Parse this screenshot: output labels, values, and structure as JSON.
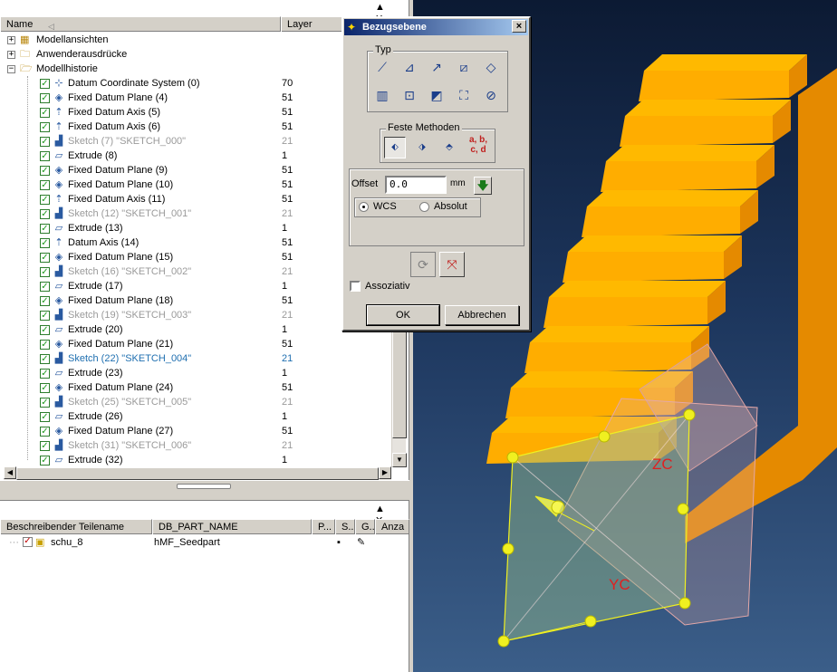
{
  "navigator": {
    "columns": {
      "name": "Name",
      "layer": "Layer"
    },
    "top_nodes": [
      {
        "label": "Modellansichten",
        "icon": "model-views-icon"
      },
      {
        "label": "Anwenderausdrücke",
        "icon": "folder-icon"
      },
      {
        "label": "Modellhistorie",
        "icon": "folder-open-icon"
      }
    ],
    "features": [
      {
        "label": "Datum Coordinate System (0)",
        "layer": "70",
        "state": "normal",
        "icon": "csys-icon"
      },
      {
        "label": "Fixed Datum Plane (4)",
        "layer": "51",
        "state": "normal",
        "icon": "datum-plane-icon"
      },
      {
        "label": "Fixed Datum Axis (5)",
        "layer": "51",
        "state": "normal",
        "icon": "datum-axis-icon"
      },
      {
        "label": "Fixed Datum Axis (6)",
        "layer": "51",
        "state": "normal",
        "icon": "datum-axis-icon"
      },
      {
        "label": "Sketch (7) \"SKETCH_000\"",
        "layer": "21",
        "state": "dim",
        "icon": "sketch-icon"
      },
      {
        "label": "Extrude (8)",
        "layer": "1",
        "state": "normal",
        "icon": "extrude-icon"
      },
      {
        "label": "Fixed Datum Plane (9)",
        "layer": "51",
        "state": "normal",
        "icon": "datum-plane-icon"
      },
      {
        "label": "Fixed Datum Plane (10)",
        "layer": "51",
        "state": "normal",
        "icon": "datum-plane-icon"
      },
      {
        "label": "Fixed Datum Axis (11)",
        "layer": "51",
        "state": "normal",
        "icon": "datum-axis-icon"
      },
      {
        "label": "Sketch (12) \"SKETCH_001\"",
        "layer": "21",
        "state": "dim",
        "icon": "sketch-icon"
      },
      {
        "label": "Extrude (13)",
        "layer": "1",
        "state": "normal",
        "icon": "extrude-icon"
      },
      {
        "label": "Datum Axis (14)",
        "layer": "51",
        "state": "normal",
        "icon": "datum-axis-icon"
      },
      {
        "label": "Fixed Datum Plane (15)",
        "layer": "51",
        "state": "normal",
        "icon": "datum-plane-icon"
      },
      {
        "label": "Sketch (16) \"SKETCH_002\"",
        "layer": "21",
        "state": "dim",
        "icon": "sketch-icon"
      },
      {
        "label": "Extrude (17)",
        "layer": "1",
        "state": "normal",
        "icon": "extrude-icon"
      },
      {
        "label": "Fixed Datum Plane (18)",
        "layer": "51",
        "state": "normal",
        "icon": "datum-plane-icon"
      },
      {
        "label": "Sketch (19) \"SKETCH_003\"",
        "layer": "21",
        "state": "dim",
        "icon": "sketch-icon"
      },
      {
        "label": "Extrude (20)",
        "layer": "1",
        "state": "normal",
        "icon": "extrude-icon"
      },
      {
        "label": "Fixed Datum Plane (21)",
        "layer": "51",
        "state": "normal",
        "icon": "datum-plane-icon"
      },
      {
        "label": "Sketch (22) \"SKETCH_004\"",
        "layer": "21",
        "state": "active",
        "icon": "sketch-icon"
      },
      {
        "label": "Extrude (23)",
        "layer": "1",
        "state": "normal",
        "icon": "extrude-icon"
      },
      {
        "label": "Fixed Datum Plane (24)",
        "layer": "51",
        "state": "normal",
        "icon": "datum-plane-icon"
      },
      {
        "label": "Sketch (25) \"SKETCH_005\"",
        "layer": "21",
        "state": "dim",
        "icon": "sketch-icon"
      },
      {
        "label": "Extrude (26)",
        "layer": "1",
        "state": "normal",
        "icon": "extrude-icon"
      },
      {
        "label": "Fixed Datum Plane (27)",
        "layer": "51",
        "state": "normal",
        "icon": "datum-plane-icon"
      },
      {
        "label": "Sketch (31) \"SKETCH_006\"",
        "layer": "21",
        "state": "dim",
        "icon": "sketch-icon"
      },
      {
        "label": "Extrude (32)",
        "layer": "1",
        "state": "normal",
        "icon": "extrude-icon"
      }
    ]
  },
  "parts": {
    "columns": [
      "Beschreibender Teilename",
      "DB_PART_NAME",
      "P...",
      "S...",
      "G...",
      "Anza"
    ],
    "row": {
      "name": "schu_8",
      "db_part_name": "hMF_Seedpart"
    }
  },
  "dialog": {
    "title": "Bezugsebene",
    "close": "×",
    "type_group": "Typ",
    "fixed_group": "Feste Methoden",
    "abcd": "a, b,\nc, d",
    "offset_label": "Offset",
    "offset_value": "0.0",
    "offset_unit": "mm",
    "radio_wcs": "WCS",
    "radio_absolute": "Absolut",
    "associative": "Assoziativ",
    "ok": "OK",
    "cancel": "Abbrechen"
  },
  "viewport": {
    "labels": {
      "zc": "ZC",
      "yc": "YC"
    },
    "colors": {
      "solid_front": "#ffad00",
      "solid_top": "#ffb900",
      "solid_side": "#e58a00",
      "plane_edge": "#f0f020"
    }
  }
}
